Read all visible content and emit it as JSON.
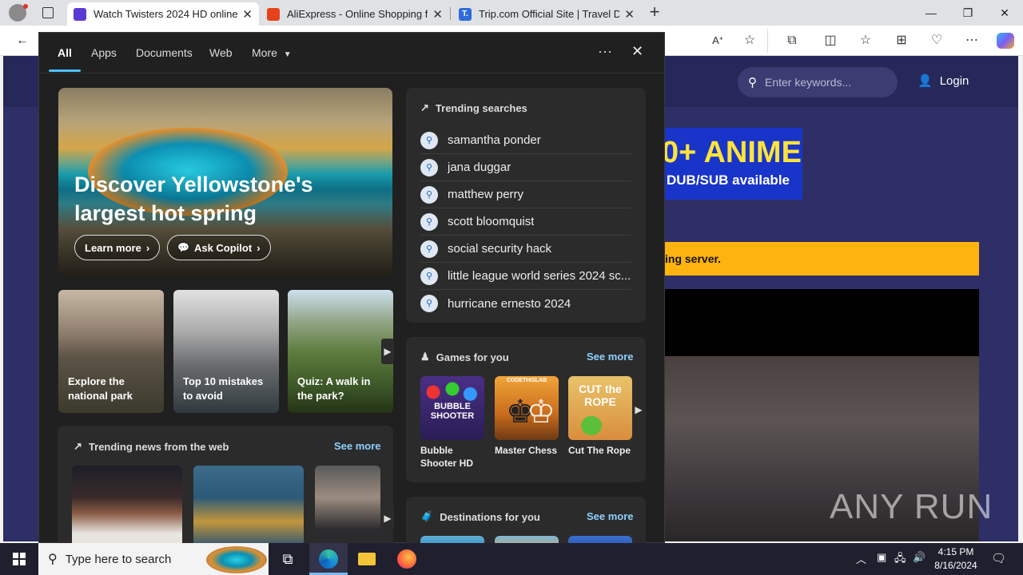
{
  "browser": {
    "tabs": [
      {
        "title": "Watch Twisters 2024 HD online",
        "favicon_color": "#5b3bd4",
        "active": true
      },
      {
        "title": "AliExpress - Online Shopping für",
        "favicon_color": "#e8421c",
        "active": false
      },
      {
        "title": "Trip.com Official Site | Travel Deal",
        "favicon_color": "#2f6bd9",
        "favicon_text": "T.",
        "active": false
      }
    ],
    "new_tab_icon": "plus-icon",
    "window_controls": [
      "minimize-icon",
      "restore-icon",
      "close-icon"
    ],
    "toolbar_icons": [
      "read-aloud-icon",
      "favorite-star-icon",
      "extensions-icon",
      "split-screen-icon",
      "favorites-icon",
      "collections-icon",
      "browser-essentials-icon",
      "more-icon",
      "copilot-icon"
    ]
  },
  "site": {
    "search_placeholder": "Enter keywords...",
    "login_label": "Login",
    "banner_big": "0+ ANIME",
    "banner_small": "DUB/SUB available",
    "notice": "ing server.",
    "watermark": "ANY RUN"
  },
  "flyout": {
    "filters": [
      "All",
      "Apps",
      "Documents",
      "Web",
      "More"
    ],
    "active_filter": "All",
    "hero": {
      "title": "Discover Yellowstone's largest hot spring",
      "learn_more": "Learn more",
      "ask_copilot": "Ask Copilot"
    },
    "thumbs": [
      {
        "caption": "Explore the national park"
      },
      {
        "caption": "Top 10 mistakes to avoid"
      },
      {
        "caption": "Quiz: A walk in the park?"
      }
    ],
    "trending": {
      "title": "Trending searches",
      "items": [
        "samantha ponder",
        "jana duggar",
        "matthew perry",
        "scott bloomquist",
        "social security hack",
        "little league world series 2024 sc...",
        "hurricane ernesto 2024"
      ]
    },
    "games": {
      "title": "Games for you",
      "see_more": "See more",
      "items": [
        {
          "name": "Bubble Shooter HD",
          "thumb_text": "BUBBLE SHOOTER"
        },
        {
          "name": "Master Chess",
          "thumb_text": "CODETHISLAB"
        },
        {
          "name": "Cut The Rope",
          "thumb_text": "CUT the ROPE"
        }
      ]
    },
    "news": {
      "title": "Trending news from the web",
      "see_more": "See more"
    },
    "destinations": {
      "title": "Destinations for you",
      "see_more": "See more"
    }
  },
  "taskbar": {
    "search_placeholder": "Type here to search",
    "time": "4:15 PM",
    "date": "8/16/2024"
  }
}
